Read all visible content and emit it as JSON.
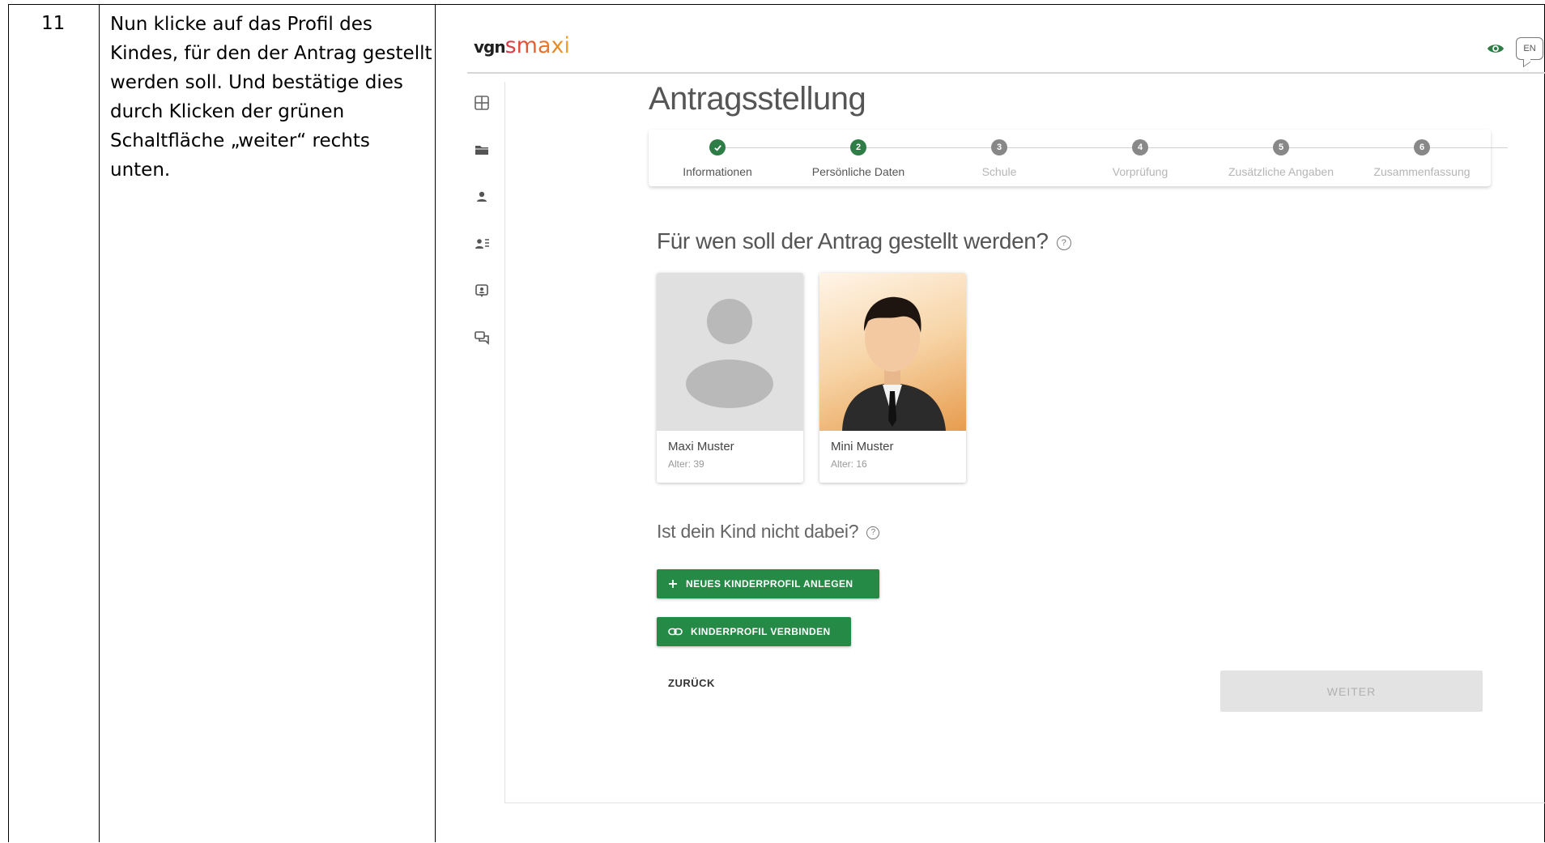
{
  "document": {
    "step_number": "11",
    "instruction": "Nun klicke auf das Profil des Kindes, für den der Antrag gestellt werden soll. Und bestätige dies durch Klicken der grünen Schaltfläche „weiter“ rechts unten."
  },
  "app": {
    "logo": {
      "part1": "vgn",
      "part2": "smaxi"
    },
    "language": "EN",
    "colors": {
      "primary_green": "#268a47",
      "step_green": "#2e7d46",
      "accent": "#2e9a4e"
    },
    "sidenav": [
      {
        "icon": "dashboard-icon"
      },
      {
        "icon": "folder-icon"
      },
      {
        "icon": "person-icon"
      },
      {
        "icon": "person-list-icon"
      },
      {
        "icon": "id-card-icon"
      },
      {
        "icon": "chat-icon"
      }
    ],
    "page_title": "Antragsstellung",
    "stepper": [
      {
        "num": "1",
        "label": "Informationen",
        "state": "done"
      },
      {
        "num": "2",
        "label": "Persönliche Daten",
        "state": "active"
      },
      {
        "num": "3",
        "label": "Schule",
        "state": "todo"
      },
      {
        "num": "4",
        "label": "Vorprüfung",
        "state": "todo"
      },
      {
        "num": "5",
        "label": "Zusätzliche Angaben",
        "state": "todo"
      },
      {
        "num": "6",
        "label": "Zusammenfassung",
        "state": "todo"
      }
    ],
    "question": "Für wen soll der Antrag gestellt werden?",
    "help_glyph": "?",
    "profiles": [
      {
        "name": "Maxi Muster",
        "age": "Alter: 39"
      },
      {
        "name": "Mini Muster",
        "age": "Alter: 16"
      }
    ],
    "question2": "Ist dein Kind nicht dabei?",
    "buttons": {
      "new_profile": "NEUES KINDERPROFIL ANLEGEN",
      "link_profile": "KINDERPROFIL VERBINDEN",
      "back": "ZURÜCK",
      "next": "WEITER"
    }
  }
}
